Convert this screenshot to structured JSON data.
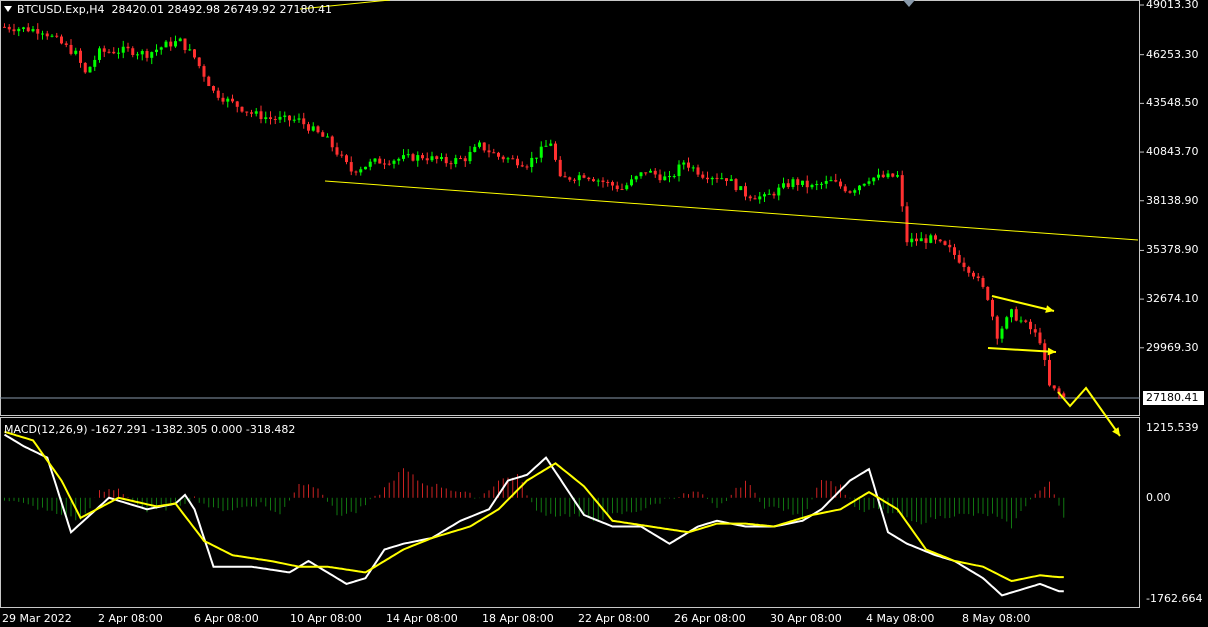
{
  "header": {
    "symbol": "BTCUSD.Exp,H4",
    "ohlc": "28420.01 28492.98 26749.92 27180.41"
  },
  "macd_header": "MACD(12,26,9) -1627.291 -1382.305 0.000 -318.482",
  "current_price": "27180.41",
  "colors": {
    "bull": "#00ff00",
    "bear": "#ff3030",
    "trend": "#ffff00",
    "macd": "#ffffff",
    "signal": "#ffff00",
    "hist_pos": "#cc2222",
    "hist_neg": "#117711"
  },
  "chart_data": [
    {
      "type": "candlestick",
      "title": "BTCUSD.Exp,H4",
      "y_ticks": [
        "49013.30",
        "46253.30",
        "43548.50",
        "40843.70",
        "38138.90",
        "35378.90",
        "32674.10",
        "29969.30"
      ],
      "ylim": [
        27180.41,
        49013.3
      ],
      "x_ticks": [
        "29 Mar 2022",
        "2 Apr 08:00",
        "6 Apr 08:00",
        "10 Apr 08:00",
        "14 Apr 08:00",
        "18 Apr 08:00",
        "22 Apr 08:00",
        "26 Apr 08:00",
        "30 Apr 08:00",
        "4 May 08:00",
        "8 May 08:00"
      ],
      "last_price": 27180.41,
      "close_path": [
        [
          0,
          47800
        ],
        [
          8,
          47600
        ],
        [
          15,
          46300
        ],
        [
          17,
          45200
        ],
        [
          20,
          46400
        ],
        [
          26,
          46500
        ],
        [
          30,
          46300
        ],
        [
          34,
          46800
        ],
        [
          37,
          47000
        ],
        [
          40,
          46100
        ],
        [
          44,
          44200
        ],
        [
          47,
          43700
        ],
        [
          52,
          43000
        ],
        [
          56,
          42700
        ],
        [
          62,
          42600
        ],
        [
          68,
          41500
        ],
        [
          73,
          39800
        ],
        [
          78,
          40300
        ],
        [
          84,
          40500
        ],
        [
          88,
          40600
        ],
        [
          93,
          40300
        ],
        [
          97,
          40500
        ],
        [
          100,
          41200
        ],
        [
          104,
          40600
        ],
        [
          110,
          40200
        ],
        [
          115,
          41400
        ],
        [
          117,
          39300
        ],
        [
          122,
          39600
        ],
        [
          130,
          38800
        ],
        [
          135,
          39800
        ],
        [
          140,
          39300
        ],
        [
          143,
          40300
        ],
        [
          147,
          39600
        ],
        [
          152,
          39400
        ],
        [
          156,
          38500
        ],
        [
          160,
          38300
        ],
        [
          166,
          39200
        ],
        [
          170,
          38900
        ],
        [
          174,
          39200
        ],
        [
          178,
          38700
        ],
        [
          182,
          39400
        ],
        [
          188,
          39500
        ],
        [
          190,
          35900
        ],
        [
          195,
          36000
        ],
        [
          199,
          35400
        ],
        [
          204,
          34100
        ],
        [
          207,
          32800
        ],
        [
          209,
          30700
        ],
        [
          212,
          31900
        ],
        [
          216,
          31000
        ],
        [
          218,
          30400
        ],
        [
          220,
          27800
        ],
        [
          223,
          27200
        ]
      ]
    },
    {
      "type": "line",
      "title": "MACD(12,26,9)",
      "y_ticks": [
        "1215.539",
        "0.00",
        "-1762.664"
      ],
      "ylim": [
        -1762.664,
        1215.539
      ],
      "series": [
        {
          "name": "MACD",
          "values": [
            [
              0,
              1100
            ],
            [
              4,
              900
            ],
            [
              9,
              700
            ],
            [
              14,
              -600
            ],
            [
              18,
              -300
            ],
            [
              22,
              0
            ],
            [
              30,
              -200
            ],
            [
              36,
              -100
            ],
            [
              38,
              50
            ],
            [
              40,
              -200
            ],
            [
              44,
              -1200
            ],
            [
              52,
              -1200
            ],
            [
              60,
              -1300
            ],
            [
              64,
              -1100
            ],
            [
              68,
              -1300
            ],
            [
              72,
              -1500
            ],
            [
              76,
              -1400
            ],
            [
              80,
              -900
            ],
            [
              84,
              -800
            ],
            [
              90,
              -700
            ],
            [
              96,
              -400
            ],
            [
              102,
              -200
            ],
            [
              106,
              300
            ],
            [
              110,
              400
            ],
            [
              114,
              700
            ],
            [
              118,
              200
            ],
            [
              122,
              -300
            ],
            [
              128,
              -500
            ],
            [
              134,
              -500
            ],
            [
              140,
              -800
            ],
            [
              146,
              -500
            ],
            [
              150,
              -400
            ],
            [
              156,
              -500
            ],
            [
              162,
              -500
            ],
            [
              168,
              -400
            ],
            [
              172,
              -200
            ],
            [
              178,
              300
            ],
            [
              182,
              500
            ],
            [
              186,
              -600
            ],
            [
              190,
              -800
            ],
            [
              196,
              -1000
            ],
            [
              200,
              -1100
            ],
            [
              206,
              -1400
            ],
            [
              210,
              -1700
            ],
            [
              214,
              -1600
            ],
            [
              218,
              -1500
            ],
            [
              222,
              -1627
            ]
          ]
        },
        {
          "name": "Signal",
          "values": [
            [
              0,
              1150
            ],
            [
              6,
              1000
            ],
            [
              12,
              300
            ],
            [
              16,
              -350
            ],
            [
              24,
              0
            ],
            [
              32,
              -150
            ],
            [
              36,
              -100
            ],
            [
              42,
              -750
            ],
            [
              48,
              -1000
            ],
            [
              56,
              -1100
            ],
            [
              62,
              -1200
            ],
            [
              68,
              -1200
            ],
            [
              76,
              -1300
            ],
            [
              84,
              -900
            ],
            [
              90,
              -700
            ],
            [
              98,
              -500
            ],
            [
              104,
              -200
            ],
            [
              110,
              300
            ],
            [
              116,
              600
            ],
            [
              122,
              200
            ],
            [
              128,
              -400
            ],
            [
              136,
              -500
            ],
            [
              144,
              -600
            ],
            [
              150,
              -450
            ],
            [
              156,
              -450
            ],
            [
              162,
              -500
            ],
            [
              170,
              -300
            ],
            [
              176,
              -200
            ],
            [
              182,
              100
            ],
            [
              188,
              -200
            ],
            [
              194,
              -900
            ],
            [
              200,
              -1100
            ],
            [
              206,
              -1200
            ],
            [
              212,
              -1450
            ],
            [
              218,
              -1350
            ],
            [
              222,
              -1382
            ]
          ]
        },
        {
          "name": "Histogram",
          "values": [
            [
              0,
              -20
            ],
            [
              8,
              -200
            ],
            [
              12,
              -300
            ],
            [
              16,
              -400
            ],
            [
              20,
              100
            ],
            [
              24,
              150
            ],
            [
              30,
              -250
            ],
            [
              36,
              -150
            ],
            [
              40,
              0
            ],
            [
              44,
              -200
            ],
            [
              48,
              -200
            ],
            [
              54,
              -100
            ],
            [
              58,
              -300
            ],
            [
              62,
              250
            ],
            [
              66,
              200
            ],
            [
              70,
              -300
            ],
            [
              74,
              -250
            ],
            [
              78,
              0
            ],
            [
              84,
              500
            ],
            [
              88,
              250
            ],
            [
              92,
              200
            ],
            [
              96,
              100
            ],
            [
              100,
              0
            ],
            [
              104,
              300
            ],
            [
              108,
              400
            ],
            [
              112,
              -250
            ],
            [
              116,
              -300
            ],
            [
              120,
              -300
            ],
            [
              124,
              -400
            ],
            [
              128,
              -300
            ],
            [
              132,
              -250
            ],
            [
              136,
              -150
            ],
            [
              140,
              0
            ],
            [
              146,
              100
            ],
            [
              150,
              -200
            ],
            [
              156,
              300
            ],
            [
              160,
              -150
            ],
            [
              164,
              -200
            ],
            [
              168,
              -350
            ],
            [
              172,
              350
            ],
            [
              176,
              200
            ],
            [
              180,
              -250
            ],
            [
              184,
              -200
            ],
            [
              188,
              -300
            ],
            [
              192,
              -450
            ],
            [
              196,
              -350
            ],
            [
              200,
              -300
            ],
            [
              204,
              -300
            ],
            [
              208,
              -300
            ],
            [
              212,
              -500
            ],
            [
              216,
              0
            ],
            [
              220,
              250
            ],
            [
              224,
              -500
            ]
          ]
        }
      ]
    }
  ]
}
